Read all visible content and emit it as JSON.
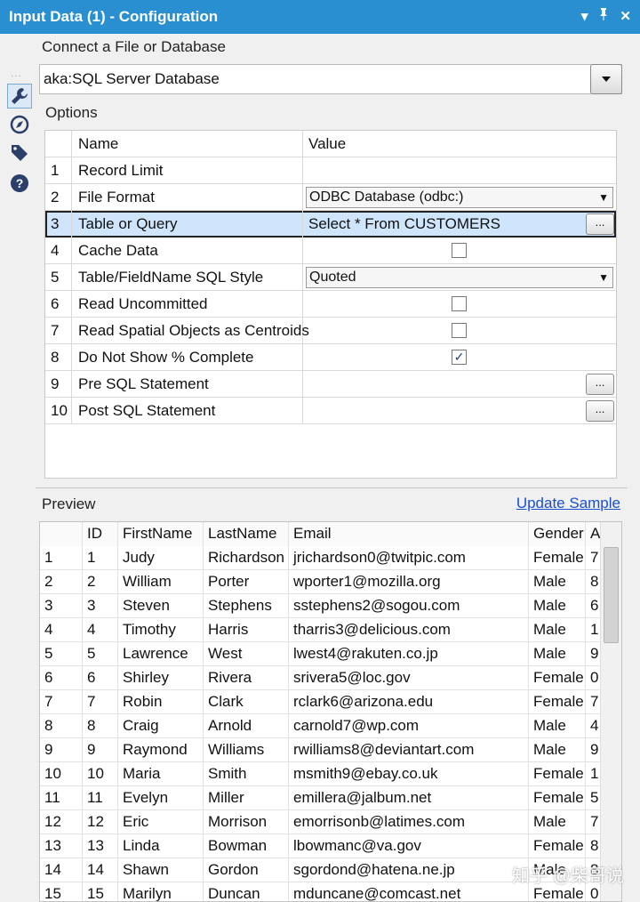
{
  "window": {
    "title": "Input Data (1) - Configuration",
    "controls": [
      "▾",
      "🖈",
      "✕"
    ]
  },
  "toolbar": {
    "icons": [
      "wrench-icon",
      "compass-icon",
      "tag-icon",
      "help-icon"
    ]
  },
  "connect": {
    "label": "Connect a File or Database",
    "value": "aka:SQL Server Database"
  },
  "options": {
    "label": "Options",
    "col_name": "Name",
    "col_value": "Value",
    "rows": [
      {
        "num": "1",
        "name": "Record Limit",
        "value": "",
        "kind": "text"
      },
      {
        "num": "2",
        "name": "File Format",
        "value": "ODBC Database (odbc:)",
        "kind": "dropdown"
      },
      {
        "num": "3",
        "name": "Table or Query",
        "value": "Select * From CUSTOMERS",
        "kind": "ellipsis"
      },
      {
        "num": "4",
        "name": "Cache Data",
        "value": "",
        "kind": "checkbox",
        "checked": false
      },
      {
        "num": "5",
        "name": "Table/FieldName SQL Style",
        "value": "Quoted",
        "kind": "dropdown"
      },
      {
        "num": "6",
        "name": "Read Uncommitted",
        "value": "",
        "kind": "checkbox",
        "checked": false
      },
      {
        "num": "7",
        "name": "Read Spatial Objects as Centroids",
        "value": "",
        "kind": "checkbox",
        "checked": false
      },
      {
        "num": "8",
        "name": "Do Not Show % Complete",
        "value": "",
        "kind": "checkbox",
        "checked": true
      },
      {
        "num": "9",
        "name": "Pre SQL Statement",
        "value": "",
        "kind": "ellipsis"
      },
      {
        "num": "10",
        "name": "Post SQL Statement",
        "value": "",
        "kind": "ellipsis"
      }
    ],
    "ellipsis_label": "..."
  },
  "preview": {
    "label": "Preview",
    "update_link": "Update Sample",
    "columns": [
      "",
      "ID",
      "FirstName",
      "LastName",
      "Email",
      "Gender",
      "A"
    ],
    "rows": [
      [
        "1",
        "1",
        "Judy",
        "Richardson",
        "jrichardson0@twitpic.com",
        "Female",
        "7"
      ],
      [
        "2",
        "2",
        "William",
        "Porter",
        "wporter1@mozilla.org",
        "Male",
        "8"
      ],
      [
        "3",
        "3",
        "Steven",
        "Stephens",
        "sstephens2@sogou.com",
        "Male",
        "6"
      ],
      [
        "4",
        "4",
        "Timothy",
        "Harris",
        "tharris3@delicious.com",
        "Male",
        "1"
      ],
      [
        "5",
        "5",
        "Lawrence",
        "West",
        "lwest4@rakuten.co.jp",
        "Male",
        "9"
      ],
      [
        "6",
        "6",
        "Shirley",
        "Rivera",
        "srivera5@loc.gov",
        "Female",
        "0"
      ],
      [
        "7",
        "7",
        "Robin",
        "Clark",
        "rclark6@arizona.edu",
        "Female",
        "7"
      ],
      [
        "8",
        "8",
        "Craig",
        "Arnold",
        "carnold7@wp.com",
        "Male",
        "4"
      ],
      [
        "9",
        "9",
        "Raymond",
        "Williams",
        "rwilliams8@deviantart.com",
        "Male",
        "9"
      ],
      [
        "10",
        "10",
        "Maria",
        "Smith",
        "msmith9@ebay.co.uk",
        "Female",
        "1"
      ],
      [
        "11",
        "11",
        "Evelyn",
        "Miller",
        "emillera@jalbum.net",
        "Female",
        "5"
      ],
      [
        "12",
        "12",
        "Eric",
        "Morrison",
        "emorrisonb@latimes.com",
        "Male",
        "7"
      ],
      [
        "13",
        "13",
        "Linda",
        "Bowman",
        "lbowmanc@va.gov",
        "Female",
        "8"
      ],
      [
        "14",
        "14",
        "Shawn",
        "Gordon",
        "sgordond@hatena.ne.jp",
        "Male",
        "8"
      ],
      [
        "15",
        "15",
        "Marilyn",
        "Duncan",
        "mduncane@comcast.net",
        "Female",
        "0"
      ]
    ]
  },
  "watermark": "知乎 @柴哥说",
  "colors": {
    "titlebar": "#2a8fd0",
    "selection": "#cfe5fb",
    "link": "#1a4fcf"
  }
}
